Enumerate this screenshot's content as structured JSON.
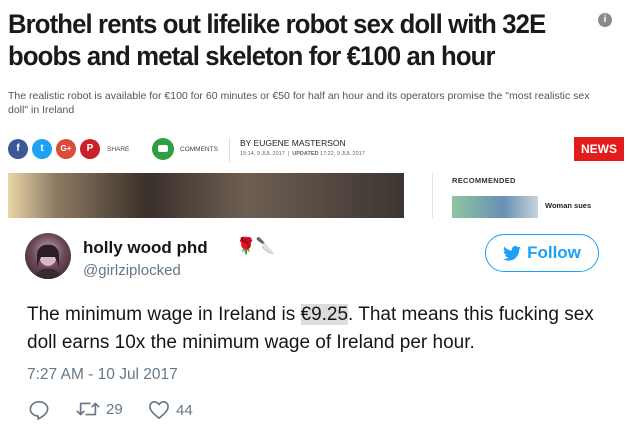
{
  "article": {
    "headline": "Brothel rents out lifelike robot sex doll with 32E boobs and metal skeleton for €100 an hour",
    "info_icon": "i",
    "standfirst": "The realistic robot is available for €100 for 60 minutes or €50 for half an hour and its operators promise the \"most realistic sex doll\" in Ireland",
    "share": {
      "facebook": "f",
      "twitter": "t",
      "googleplus": "G+",
      "pinterest": "P",
      "label": "SHARE"
    },
    "comments_label": "COMMENTS",
    "byline": "BY EUGENE MASTERSON",
    "byline_time": "15:14, 9 JUL 2017",
    "updated_label": "UPDATED",
    "updated_time": "17:22, 9 JUL 2017",
    "news_badge": "NEWS",
    "recommended_label": "RECOMMENDED",
    "recommended_title": "Woman sues"
  },
  "tweet": {
    "display_name": "holly wood phd",
    "name_emojis": "🌹🔪",
    "handle": "@girlziplocked",
    "follow_label": "Follow",
    "text_before": "The minimum wage in Ireland is ",
    "text_highlight": "€9.25",
    "text_after": ". That means this fucking sex doll earns 10x the minimum wage of Ireland per hour.",
    "timestamp": "7:27 AM - 10 Jul 2017",
    "retweets": "29",
    "likes": "44"
  },
  "colors": {
    "twitter_blue": "#1da1f2",
    "news_red": "#e31b1b",
    "muted_text": "#657786"
  },
  "icons": [
    "info-icon",
    "facebook-icon",
    "twitter-icon",
    "googleplus-icon",
    "pinterest-icon",
    "comments-icon",
    "twitter-bird-icon",
    "reply-icon",
    "retweet-icon",
    "heart-icon"
  ]
}
